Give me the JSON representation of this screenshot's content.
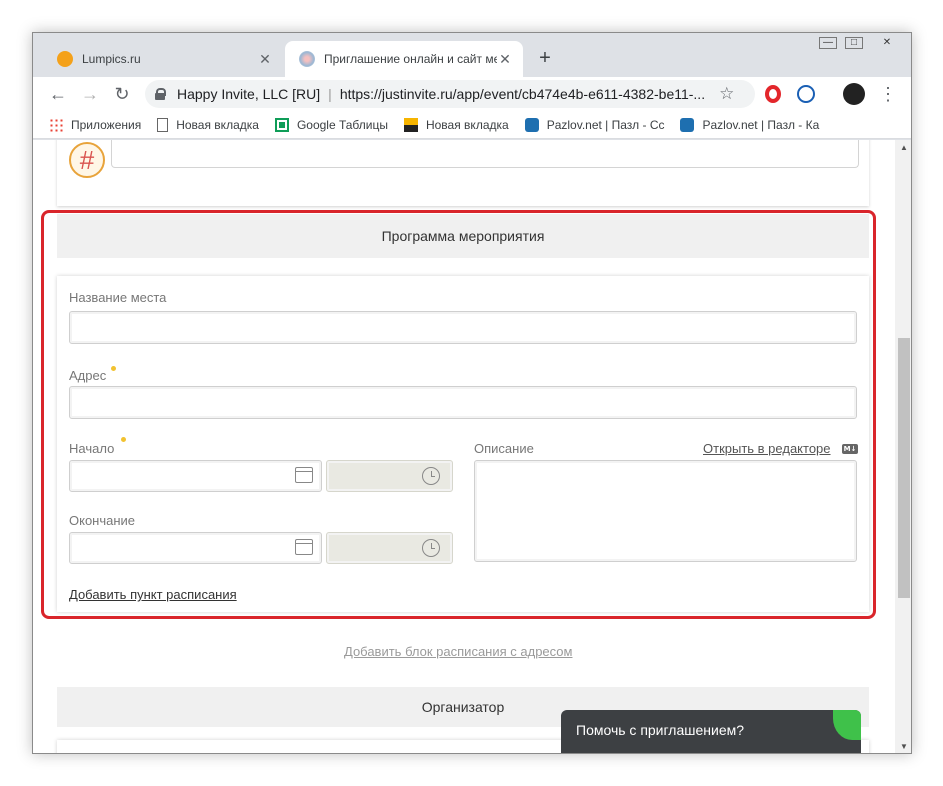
{
  "browser": {
    "tabs": [
      {
        "title": "Lumpics.ru",
        "active": false,
        "favicon_color": "#f4a11a"
      },
      {
        "title": "Приглашение онлайн и сайт ме",
        "active": true,
        "favicon_color": "#9bb7d4"
      }
    ],
    "new_tab_label": "+",
    "window_controls": {
      "minimize": "—",
      "maximize": "□",
      "close": "✕"
    },
    "nav": {
      "back": "←",
      "forward": "→",
      "reload": "↻"
    },
    "omnibox": {
      "site_name": "Happy Invite, LLC [RU]",
      "separator": "|",
      "url": "https://justinvite.ru/app/event/cb474e4b-e611-4382-be11-...",
      "bookmark_star": "☆"
    },
    "extensions": [
      {
        "name": "opera-icon",
        "color": "#e3262b"
      },
      {
        "name": "globe-icon",
        "color": "#1a5fb4"
      },
      {
        "name": "avatar-icon",
        "color": "#222222"
      }
    ],
    "menu_dots": "⋮",
    "bookmarks": [
      {
        "label": "Приложения",
        "icon": "apps-grid-icon"
      },
      {
        "label": "Новая вкладка",
        "icon": "page-icon"
      },
      {
        "label": "Google Таблицы",
        "icon": "sheets-icon"
      },
      {
        "label": "Новая вкладка",
        "icon": "image-icon"
      },
      {
        "label": "Pazlov.net | Пазл - Сс",
        "icon": "puzzle-icon"
      },
      {
        "label": "Pazlov.net | Пазл - Ка",
        "icon": "puzzle-icon"
      }
    ]
  },
  "scrollbar": {
    "up": "▲",
    "down": "▼"
  },
  "schedule": {
    "section_title": "Программа мероприятия",
    "place_name_label": "Название места",
    "place_name_value": "",
    "address_label": "Адрес",
    "address_value": "",
    "start_label": "Начало",
    "start_date": "",
    "start_time": "",
    "end_label": "Окончание",
    "end_date": "",
    "end_time": "",
    "description_label": "Описание",
    "open_editor_link": "Открыть в редакторе",
    "markdown_badge": "M↓",
    "description_value": "",
    "add_item_link": "Добавить пункт расписания",
    "accent_color": "#d9252b"
  },
  "add_block_link": "Добавить блок расписания с адресом",
  "organizer": {
    "section_title": "Организатор"
  },
  "chat": {
    "label": "Помочь с приглашением?"
  }
}
